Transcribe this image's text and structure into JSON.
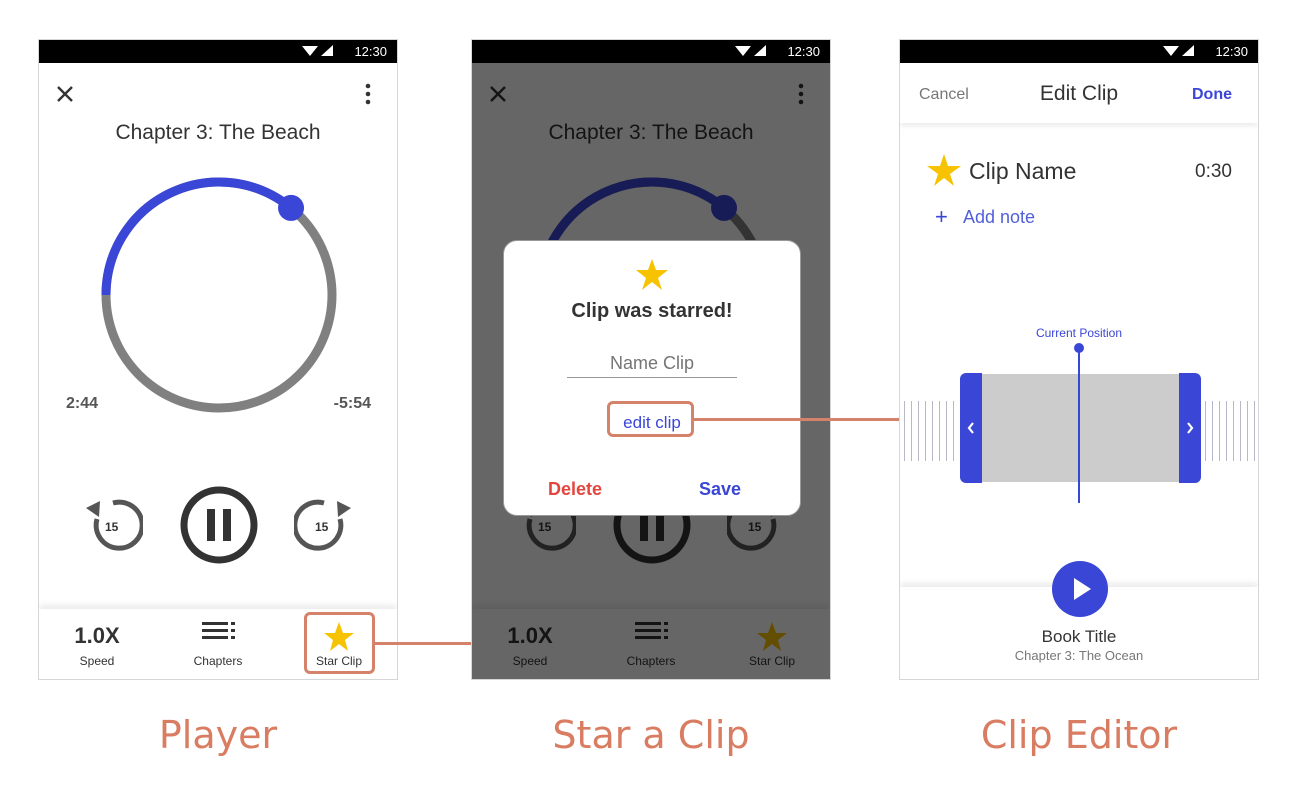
{
  "colors": {
    "accent": "#3a46d6",
    "star": "#f7c300",
    "delete": "#e2463f",
    "annotation": "#d4826a",
    "progress_track": "#808080"
  },
  "status_bar": {
    "time": "12:30"
  },
  "player": {
    "close_icon": "close-icon",
    "menu_icon": "more-vertical-icon",
    "chapter_title": "Chapter 3: The Beach",
    "progress": 0.36,
    "elapsed": "2:44",
    "remaining": "-5:54",
    "rewind_seconds": "15",
    "forward_seconds": "15",
    "nav": {
      "speed_value": "1.0X",
      "speed_label": "Speed",
      "chapters_label": "Chapters",
      "star_label": "Star Clip"
    }
  },
  "star_clip": {
    "dialog_title": "Clip was starred!",
    "name_placeholder": "Name Clip",
    "edit_link": "edit clip",
    "delete_label": "Delete",
    "save_label": "Save"
  },
  "clip_editor": {
    "cancel_label": "Cancel",
    "header_title": "Edit Clip",
    "done_label": "Done",
    "clip_name": "Clip Name",
    "clip_duration": "0:30",
    "add_note_label": "Add note",
    "current_position_label": "Current Position",
    "book_title": "Book Title",
    "chapter_subtitle": "Chapter 3: The Ocean"
  },
  "captions": {
    "player": "Player",
    "star": "Star a Clip",
    "editor": "Clip Editor"
  }
}
